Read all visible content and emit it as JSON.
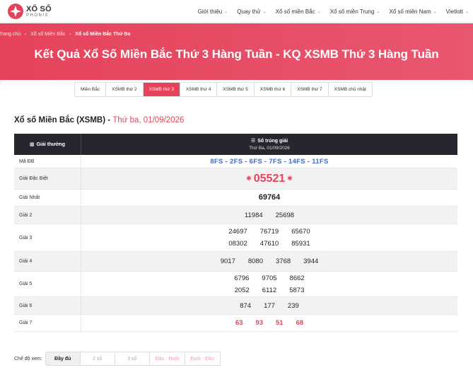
{
  "brand": {
    "name": "XỔ SỐ",
    "sub": "PHONIX",
    "accent": "#e5435b"
  },
  "nav": [
    {
      "label": "Giới thiệu",
      "dropdown": true
    },
    {
      "label": "Quay thử",
      "dropdown": true
    },
    {
      "label": "Xổ số miền Bắc",
      "dropdown": true
    },
    {
      "label": "Xổ số miền Trung",
      "dropdown": true
    },
    {
      "label": "Xổ số miền Nam",
      "dropdown": true
    },
    {
      "label": "Vietlott",
      "dropdown": true
    }
  ],
  "breadcrumb": [
    "Trang chủ",
    "Xổ số Miền Bắc",
    "Xổ số Miền Bắc Thứ Ba"
  ],
  "hero_title": "Kết Quả Xổ Số Miền Bắc Thứ 3 Hàng Tuần - KQ XSMB Thứ 3 Hàng Tuần",
  "tabs": [
    {
      "label": "Miền Bắc",
      "active": false
    },
    {
      "label": "XSMB thứ 2",
      "active": false
    },
    {
      "label": "XSMB thứ 3",
      "active": true
    },
    {
      "label": "XSMB thứ 4",
      "active": false
    },
    {
      "label": "XSMB thứ 5",
      "active": false
    },
    {
      "label": "XSMB thứ 6",
      "active": false
    },
    {
      "label": "XSMB thứ 7",
      "active": false
    },
    {
      "label": "XSMB chủ nhật",
      "active": false
    }
  ],
  "section": {
    "title": "Xổ số Miền Bắc (XSMB)",
    "dash": " - ",
    "date": "Thứ ba, 01/09/2026"
  },
  "table": {
    "col1": "Giải thưởng",
    "col2": "Số trúng giải",
    "col2_sub": "Thứ Ba, 01/09/2026",
    "rows": [
      {
        "label": "Mã ĐB",
        "kind": "mdb",
        "lines": [
          [
            "8FS - 2FS - 6FS - 7FS - 14FS - 11FS"
          ]
        ]
      },
      {
        "label": "Giải Đặc Biệt",
        "kind": "db",
        "lines": [
          [
            "05521"
          ]
        ]
      },
      {
        "label": "Giải Nhất",
        "kind": "g1",
        "lines": [
          [
            "69764"
          ]
        ]
      },
      {
        "label": "Giải 2",
        "kind": "normal",
        "lines": [
          [
            "11984",
            "25698"
          ]
        ]
      },
      {
        "label": "Giải 3",
        "kind": "normal",
        "lines": [
          [
            "24697",
            "76719",
            "65670"
          ],
          [
            "08302",
            "47610",
            "85931"
          ]
        ]
      },
      {
        "label": "Giải 4",
        "kind": "normal",
        "lines": [
          [
            "9017",
            "8080",
            "3768",
            "3944"
          ]
        ]
      },
      {
        "label": "Giải 5",
        "kind": "normal",
        "lines": [
          [
            "6796",
            "9705",
            "8662"
          ],
          [
            "2052",
            "6112",
            "5873"
          ]
        ]
      },
      {
        "label": "Giải 6",
        "kind": "normal",
        "lines": [
          [
            "874",
            "177",
            "239"
          ]
        ]
      },
      {
        "label": "Giải 7",
        "kind": "red",
        "lines": [
          [
            "63",
            "93",
            "51",
            "68"
          ]
        ]
      }
    ]
  },
  "mode": {
    "label": "Chế độ xem:",
    "options": [
      "Đầy đủ",
      "2 số",
      "3 số",
      "Đầu - Đuôi",
      "Đuôi - Đầu"
    ],
    "active": 0
  }
}
